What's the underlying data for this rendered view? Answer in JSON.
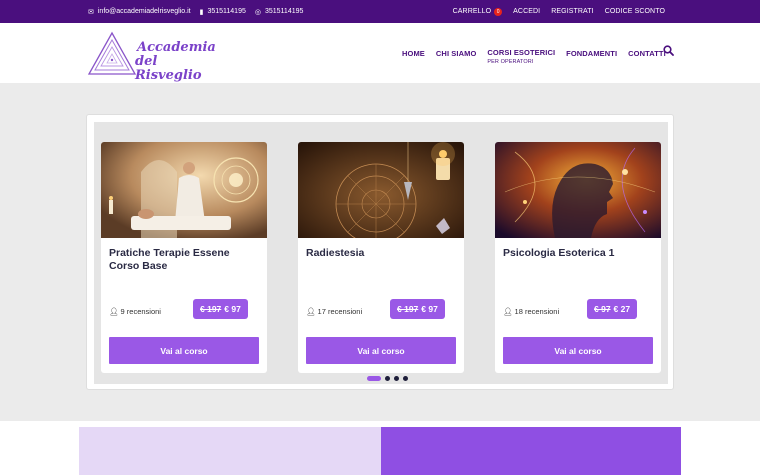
{
  "topbar": {
    "email": "info@accademiadelrisveglio.it",
    "phone": "3515114195",
    "whatsapp": "3515114195",
    "cart_label": "CARRELLO",
    "cart_count": "0",
    "login": "ACCEDI",
    "register": "REGISTRATI",
    "discount": "CODICE SCONTO"
  },
  "logo": {
    "line1": "Accademia",
    "line2": "del Risveglio"
  },
  "nav": {
    "home": "HOME",
    "about": "CHI SIAMO",
    "courses": "CORSI ESOTERICI",
    "courses_sub": "PER OPERATORI",
    "fundamentals": "FONDAMENTI",
    "contacts": "CONTATTI"
  },
  "courses": [
    {
      "title": "Pratiche Terapie Essene Corso Base",
      "reviews": "9 recensioni",
      "old_price": "€ 197",
      "price": "€ 97",
      "button": "Vai al corso"
    },
    {
      "title": "Radiestesia",
      "reviews": "17 recensioni",
      "old_price": "€ 197",
      "price": "€ 97",
      "button": "Vai al corso"
    },
    {
      "title": "Psicologia Esoterica 1",
      "reviews": "18 recensioni",
      "old_price": "€ 97",
      "price": "€ 27",
      "button": "Vai al corso"
    }
  ],
  "colors": {
    "brand": "#4a0f7e",
    "accent": "#9a58e6",
    "badge": "#e8231c"
  }
}
